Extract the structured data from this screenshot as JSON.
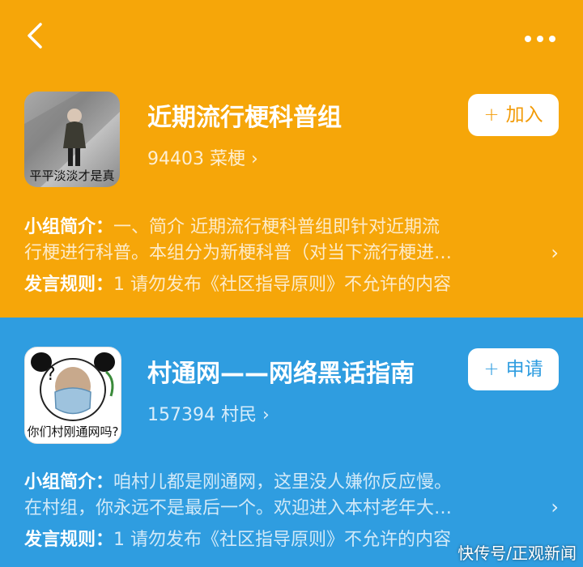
{
  "groups": [
    {
      "title": "近期流行梗科普组",
      "count": "94403",
      "member_name": "菜梗",
      "avatar_caption": "平平淡淡才是真",
      "join_label": "加入",
      "desc_label": "小组简介：",
      "desc_line1": "一、简介 近期流行梗科普组即针对近期流",
      "desc_line2": "行梗进行科普。本组分为新梗科普（对当下流行梗进…",
      "rules_label": "发言规则：",
      "rules_text": "1 请勿发布《社区指导原则》不允许的内容"
    },
    {
      "title": "村通网——网络黑话指南",
      "count": "157394",
      "member_name": "村民",
      "avatar_caption": "你们村刚通网吗?",
      "join_label": "申请",
      "desc_label": "小组简介：",
      "desc_line1": "咱村儿都是刚通网，这里没人嫌你反应慢。",
      "desc_line2": "在村组，你永远不是最后一个。欢迎进入本村老年大…",
      "rules_label": "发言规则：",
      "rules_text": "1 请勿发布《社区指导原则》不允许的内容"
    }
  ],
  "watermark": "快传号/正观新闻",
  "colors": {
    "orange": "#f6a609",
    "blue": "#2f9de0"
  }
}
